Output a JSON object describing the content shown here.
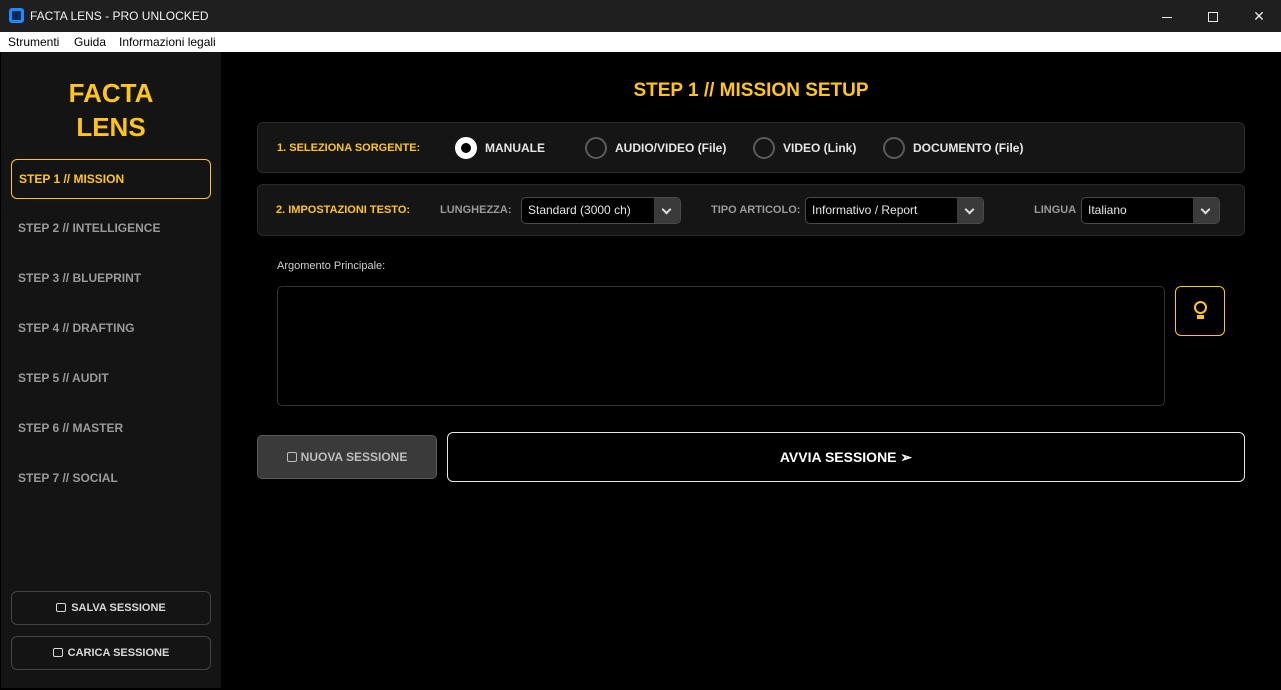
{
  "window": {
    "title": "FACTA LENS - PRO UNLOCKED",
    "icon": "app-icon",
    "controls": [
      "minimize-icon",
      "maximize-icon",
      "close-icon"
    ]
  },
  "menubar": {
    "items": [
      "Strumenti",
      "Guida",
      "Informazioni legali"
    ]
  },
  "sidebar": {
    "logo_line1": "FACTA",
    "logo_line2": "LENS",
    "steps": [
      {
        "label": "STEP 1 // MISSION",
        "active": true
      },
      {
        "label": "STEP 2 // INTELLIGENCE",
        "active": false
      },
      {
        "label": "STEP 3 // BLUEPRINT",
        "active": false
      },
      {
        "label": "STEP 4 // DRAFTING",
        "active": false
      },
      {
        "label": "STEP 5 // AUDIT",
        "active": false
      },
      {
        "label": "STEP 6 // MASTER",
        "active": false
      },
      {
        "label": "STEP 7 // SOCIAL",
        "active": false
      }
    ],
    "save_label": "SALVA SESSIONE",
    "load_label": "CARICA SESSIONE"
  },
  "main": {
    "title": "STEP 1 // MISSION SETUP",
    "source": {
      "label": "1. SELEZIONA SORGENTE:",
      "options": [
        {
          "label": "MANUALE",
          "selected": true
        },
        {
          "label": "AUDIO/VIDEO (File)",
          "selected": false
        },
        {
          "label": "VIDEO (Link)",
          "selected": false
        },
        {
          "label": "DOCUMENTO (File)",
          "selected": false
        }
      ]
    },
    "text_settings": {
      "label": "2. IMPOSTAZIONI TESTO:",
      "length_label": "LUNGHEZZA:",
      "length_value": "Standard (3000 ch)",
      "type_label": "TIPO ARTICOLO:",
      "type_value": "Informativo / Report",
      "language_label": "LINGUA",
      "language_value": "Italiano"
    },
    "topic": {
      "label": "Argomento Principale:",
      "value": ""
    },
    "new_session_label": "NUOVA SESSIONE",
    "start_session_label": "AVVIA SESSIONE ➢"
  },
  "colors": {
    "accent": "#ffc61a",
    "background": "#000000",
    "sidebar": "#141414",
    "panel": "#151515"
  }
}
